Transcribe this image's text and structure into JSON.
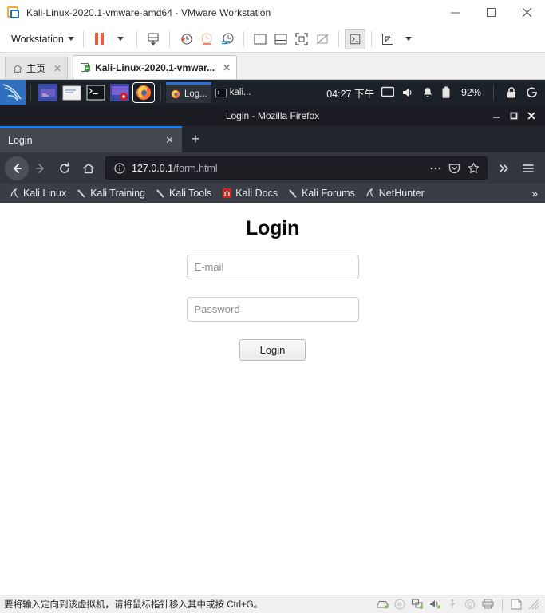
{
  "vmware": {
    "title": "Kali-Linux-2020.1-vmware-amd64 - VMware Workstation",
    "app_icon": "vmware-logo-icon",
    "window_controls": [
      {
        "name": "minimize-button",
        "glyph": "—"
      },
      {
        "name": "maximize-button",
        "glyph": "□"
      },
      {
        "name": "close-button",
        "glyph": "✕"
      }
    ],
    "toolbar": {
      "menu_label": "Workstation",
      "buttons": [
        {
          "name": "suspend-button",
          "icon": "pause-icon"
        },
        {
          "name": "suspend-dropdown",
          "icon": "caret-down-icon"
        },
        {
          "name": "power-button",
          "icon": "power-down-icon"
        },
        {
          "name": "take-snapshot-button",
          "icon": "snapshot-add-icon"
        },
        {
          "name": "revert-snapshot-button",
          "icon": "snapshot-revert-icon"
        },
        {
          "name": "snapshot-manager-button",
          "icon": "snapshot-manager-icon"
        },
        {
          "name": "show-library-button",
          "icon": "panel-left-icon"
        },
        {
          "name": "show-thumbnail-bar-button",
          "icon": "panel-bottom-icon"
        },
        {
          "name": "full-screen-button",
          "icon": "fullscreen-icon"
        },
        {
          "name": "unity-mode-button",
          "icon": "unity-off-icon"
        },
        {
          "name": "console-view-button",
          "icon": "terminal-icon"
        },
        {
          "name": "stretch-guest-button",
          "icon": "expand-diagonal-icon"
        },
        {
          "name": "stretch-dropdown",
          "icon": "caret-down-icon"
        }
      ]
    },
    "tabs": [
      {
        "name": "tab-home",
        "label": "主页",
        "icon": "home-icon",
        "selected": false,
        "close": "✕"
      },
      {
        "name": "tab-kali-vm",
        "label": "Kali-Linux-2020.1-vmwar...",
        "icon": "vm-icon",
        "selected": true,
        "close": "✕"
      }
    ],
    "status": {
      "message": "要将输入定向到该虚拟机，请将鼠标指针移入其中或按 Ctrl+G。",
      "icons": [
        {
          "name": "hard-disk-status-icon"
        },
        {
          "name": "cd-dvd-status-icon"
        },
        {
          "name": "network-adapter-status-icon"
        },
        {
          "name": "sound-card-status-icon"
        },
        {
          "name": "printer-status-icon"
        },
        {
          "name": "usb-status-icon"
        },
        {
          "name": "camera-status-icon"
        },
        {
          "name": "message-log-icon"
        },
        {
          "name": "resize-grip-icon"
        }
      ]
    }
  },
  "kali_panel": {
    "logo": "kali-dragon-icon",
    "launchers": [
      {
        "name": "launcher-show-desktop",
        "icon": "desktop-icon"
      },
      {
        "name": "launcher-file-manager",
        "icon": "folder-icon"
      },
      {
        "name": "launcher-terminal",
        "icon": "terminal-icon"
      },
      {
        "name": "launcher-metasploit",
        "icon": "metasploit-icon"
      },
      {
        "name": "launcher-firefox",
        "icon": "firefox-icon",
        "focused": true
      }
    ],
    "tasks": [
      {
        "name": "task-firefox",
        "label": "Log...",
        "icon": "firefox-icon",
        "active": true
      },
      {
        "name": "task-terminal",
        "label": "kali...",
        "icon": "terminal-icon",
        "active": false
      }
    ],
    "clock": "04:27 下午",
    "tray": [
      {
        "name": "workspace-switcher-icon"
      },
      {
        "name": "volume-icon"
      },
      {
        "name": "notification-bell-icon"
      },
      {
        "name": "battery-icon"
      }
    ],
    "battery_percent": "92%",
    "lock_icon": "lock-icon",
    "logout_icon": "power-logout-icon"
  },
  "firefox": {
    "window_title": "Login - Mozilla Firefox",
    "window_controls": [
      {
        "name": "minimize-button",
        "glyph": "—"
      },
      {
        "name": "maximize-button",
        "glyph": "❐"
      },
      {
        "name": "close-button",
        "glyph": "✕"
      }
    ],
    "tab": {
      "label": "Login",
      "close": "✕"
    },
    "new_tab_glyph": "+",
    "nav": {
      "back": "back-arrow-icon",
      "forward": "forward-arrow-icon",
      "reload": "reload-icon",
      "home": "home-icon"
    },
    "urlbar": {
      "identity_icon": "info-circle-icon",
      "url_host": "127.0.0.1",
      "url_path": "/form.html",
      "page_actions_icon": "ellipsis-icon",
      "pocket_icon": "pocket-icon",
      "bookmark_star_icon": "star-icon",
      "overflow_icon": "chevron-double-right-icon",
      "menu_icon": "hamburger-menu-icon"
    },
    "bookmarks": [
      {
        "name": "bookmark-kali-linux",
        "label": "Kali Linux",
        "icon": "kali-dragon-icon"
      },
      {
        "name": "bookmark-kali-training",
        "label": "Kali Training",
        "icon": "kali-slash-icon"
      },
      {
        "name": "bookmark-kali-tools",
        "label": "Kali Tools",
        "icon": "kali-slash-icon"
      },
      {
        "name": "bookmark-kali-docs",
        "label": "Kali Docs",
        "icon": "kali-docs-icon"
      },
      {
        "name": "bookmark-kali-forums",
        "label": "Kali Forums",
        "icon": "kali-slash-icon"
      },
      {
        "name": "bookmark-nethunter",
        "label": "NetHunter",
        "icon": "kali-dragon-icon"
      }
    ],
    "bookmarks_overflow_glyph": "»"
  },
  "page": {
    "heading": "Login",
    "email_placeholder": "E-mail",
    "email_value": "",
    "password_placeholder": "Password",
    "password_value": "",
    "submit_label": "Login"
  },
  "colors": {
    "firefox_accent": "#0a84ff",
    "kali_panel_bg": "#1c2027",
    "vmware_orange": "#e8613c"
  }
}
